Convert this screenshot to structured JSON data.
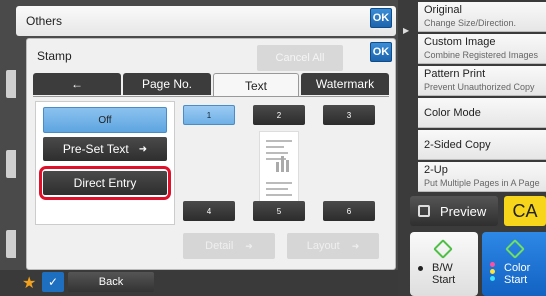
{
  "header": {
    "title": "Others",
    "ok_label": "OK"
  },
  "dialog": {
    "title": "Stamp",
    "ok_label": "OK",
    "cancel_all_label": "Cancel All",
    "tabs": [
      {
        "label": "←",
        "active": false
      },
      {
        "label": "Page No.",
        "active": false
      },
      {
        "label": "Text",
        "active": true
      },
      {
        "label": "Watermark",
        "active": false
      }
    ],
    "off_label": "Off",
    "preset_label": "Pre-Set Text",
    "direct_entry_label": "Direct Entry",
    "positions": [
      "1",
      "2",
      "3",
      "4",
      "5",
      "6"
    ],
    "selected_position": "1",
    "detail_label": "Detail",
    "layout_label": "Layout"
  },
  "footer": {
    "back_label": "Back"
  },
  "sidebar": {
    "items": [
      {
        "title": "Original",
        "subtitle": "Change Size/Direction."
      },
      {
        "title": "Custom Image",
        "subtitle": "Combine Registered Images"
      },
      {
        "title": "Pattern Print",
        "subtitle": "Prevent Unauthorized Copy"
      },
      {
        "title": "Color Mode",
        "subtitle": ""
      },
      {
        "title": "2-Sided Copy",
        "subtitle": ""
      },
      {
        "title": "2-Up",
        "subtitle": "Put Multiple Pages in A Page"
      }
    ]
  },
  "actions": {
    "preview_label": "Preview",
    "ca_label": "CA",
    "bw_label_1": "B/W",
    "bw_label_2": "Start",
    "color_label_1": "Color",
    "color_label_2": "Start"
  },
  "colors": {
    "accent": "#1f6fc0",
    "highlight": "#e0102b",
    "ca": "#f6d51b"
  }
}
